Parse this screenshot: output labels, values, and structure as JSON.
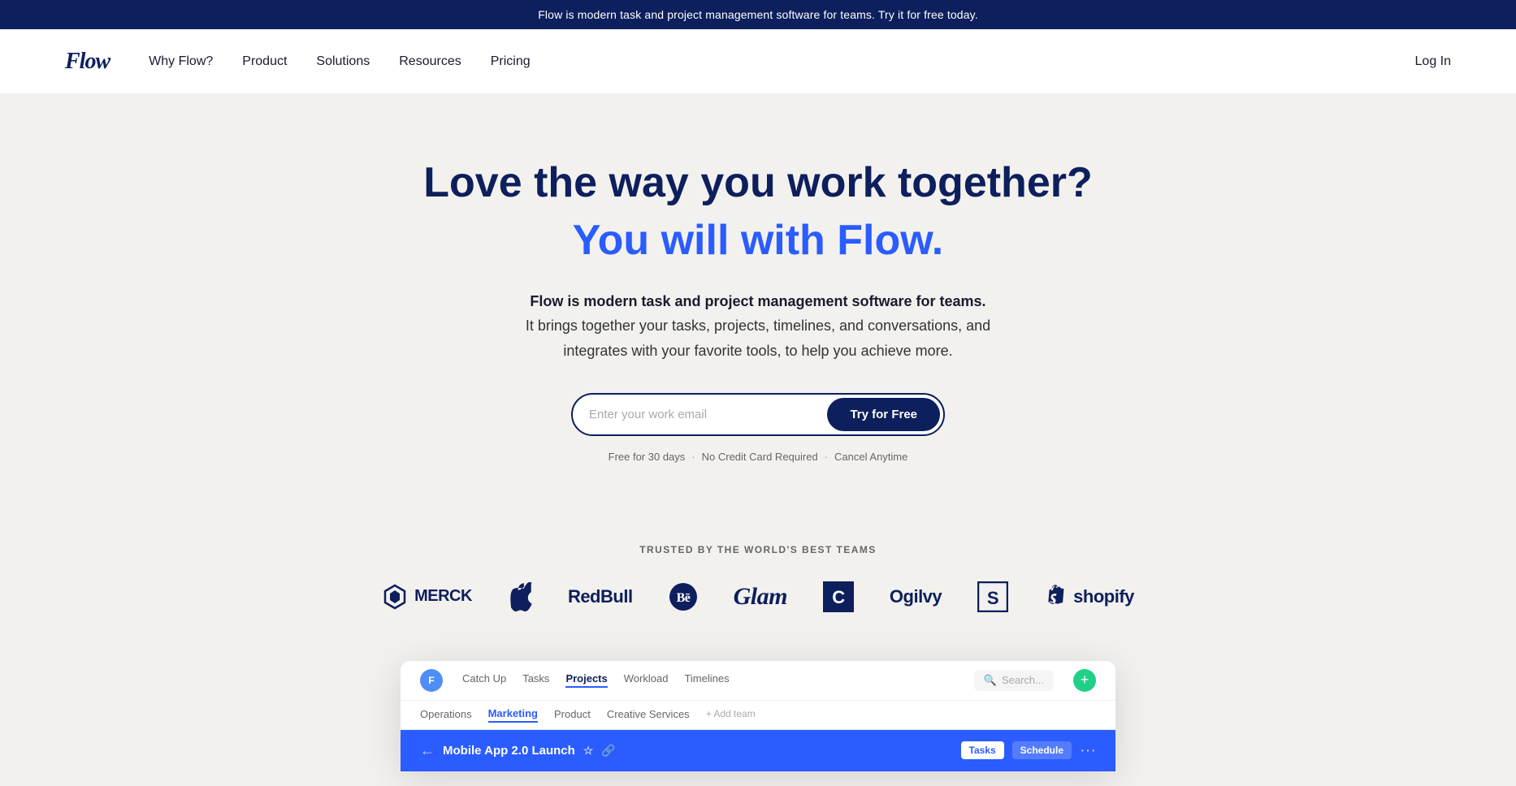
{
  "banner": {
    "text": "Flow is modern task and project management software for teams. Try it for free today."
  },
  "nav": {
    "logo": "Flow",
    "links": [
      {
        "label": "Why Flow?",
        "id": "why-flow"
      },
      {
        "label": "Product",
        "id": "product"
      },
      {
        "label": "Solutions",
        "id": "solutions"
      },
      {
        "label": "Resources",
        "id": "resources"
      },
      {
        "label": "Pricing",
        "id": "pricing"
      }
    ],
    "login": "Log In"
  },
  "hero": {
    "headline1": "Love the way you work together?",
    "headline2": "You will with Flow.",
    "sub1": "Flow is modern task and project management software for teams.",
    "sub2": "It brings together your tasks, projects, timelines, and conversations, and integrates with your favorite tools, to help you achieve more.",
    "email_placeholder": "Enter your work email",
    "cta": "Try for Free",
    "free_note": [
      "Free for 30 days",
      "No Credit Card Required",
      "Cancel Anytime"
    ]
  },
  "trusted": {
    "label": "TRUSTED BY THE WORLD'S BEST TEAMS",
    "brands": [
      {
        "name": "MERCK",
        "icon": "⬡"
      },
      {
        "name": "Apple",
        "icon": ""
      },
      {
        "name": "RedBull",
        "icon": ""
      },
      {
        "name": "Behance",
        "icon": "Bē"
      },
      {
        "name": "Glam",
        "icon": ""
      },
      {
        "name": "Carhartt",
        "icon": "C"
      },
      {
        "name": "Ogilvy",
        "icon": ""
      },
      {
        "name": "Skillshare",
        "icon": "S"
      },
      {
        "name": "shopify",
        "icon": "🛍"
      }
    ]
  },
  "app_preview": {
    "nav_tabs": [
      "Catch Up",
      "Tasks",
      "Projects",
      "Workload",
      "Timelines"
    ],
    "active_tab": "Projects",
    "search_placeholder": "Search...",
    "sub_nav": [
      "Operations",
      "Marketing",
      "Product",
      "Creative Services",
      "+ Add team"
    ],
    "active_sub": "Marketing",
    "task_title": "Mobile App 2.0 Launch",
    "task_tags": [
      "Tasks",
      "Schedule"
    ],
    "back_icon": "←",
    "more_icon": "···"
  },
  "icons": {
    "search": "🔍",
    "plus": "+",
    "merck_icon": "⬡",
    "apple_icon": "",
    "star": "★"
  }
}
